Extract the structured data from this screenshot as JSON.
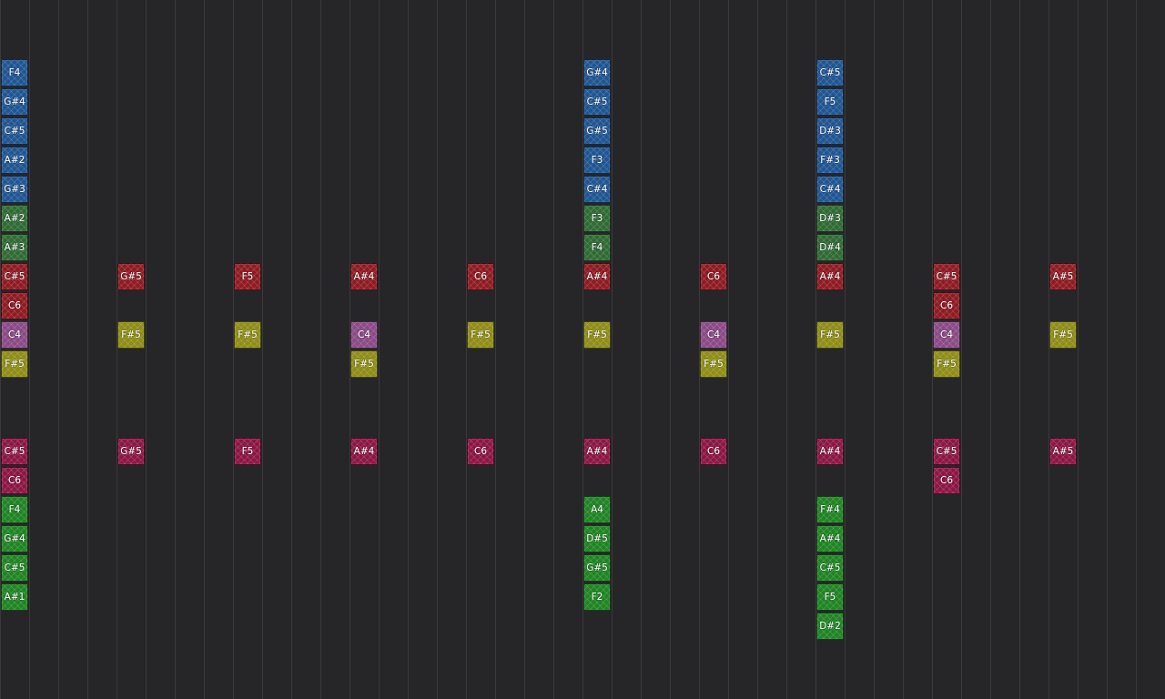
{
  "sequencer": {
    "track_colors": {
      "blue": "#1f5592",
      "dgreen": "#2f6a34",
      "red": "#8e1a22",
      "purple": "#8a4a86",
      "yellow": "#8f8d15",
      "crimson": "#8c1543",
      "green": "#1f8423"
    },
    "notes": [
      {
        "label": "F4",
        "col": 0,
        "row": 0,
        "track": "blue"
      },
      {
        "label": "G#4",
        "col": 0,
        "row": 1,
        "track": "blue"
      },
      {
        "label": "C#5",
        "col": 0,
        "row": 2,
        "track": "blue"
      },
      {
        "label": "A#2",
        "col": 0,
        "row": 3,
        "track": "blue"
      },
      {
        "label": "G#3",
        "col": 0,
        "row": 4,
        "track": "blue"
      },
      {
        "label": "A#2",
        "col": 0,
        "row": 5,
        "track": "dgreen"
      },
      {
        "label": "A#3",
        "col": 0,
        "row": 6,
        "track": "dgreen"
      },
      {
        "label": "C#5",
        "col": 0,
        "row": 7,
        "track": "red"
      },
      {
        "label": "C6",
        "col": 0,
        "row": 8,
        "track": "red"
      },
      {
        "label": "C4",
        "col": 0,
        "row": 9,
        "track": "purple"
      },
      {
        "label": "F#5",
        "col": 0,
        "row": 10,
        "track": "yellow"
      },
      {
        "label": "C#5",
        "col": 0,
        "row": 13,
        "track": "crimson"
      },
      {
        "label": "C6",
        "col": 0,
        "row": 14,
        "track": "crimson"
      },
      {
        "label": "F4",
        "col": 0,
        "row": 15,
        "track": "green"
      },
      {
        "label": "G#4",
        "col": 0,
        "row": 16,
        "track": "green"
      },
      {
        "label": "C#5",
        "col": 0,
        "row": 17,
        "track": "green"
      },
      {
        "label": "A#1",
        "col": 0,
        "row": 18,
        "track": "green"
      },
      {
        "label": "G#5",
        "col": 4,
        "row": 7,
        "track": "red"
      },
      {
        "label": "F#5",
        "col": 4,
        "row": 9,
        "track": "yellow"
      },
      {
        "label": "G#5",
        "col": 4,
        "row": 13,
        "track": "crimson"
      },
      {
        "label": "F5",
        "col": 8,
        "row": 7,
        "track": "red"
      },
      {
        "label": "F#5",
        "col": 8,
        "row": 9,
        "track": "yellow"
      },
      {
        "label": "F5",
        "col": 8,
        "row": 13,
        "track": "crimson"
      },
      {
        "label": "A#4",
        "col": 12,
        "row": 7,
        "track": "red"
      },
      {
        "label": "C4",
        "col": 12,
        "row": 9,
        "track": "purple"
      },
      {
        "label": "F#5",
        "col": 12,
        "row": 10,
        "track": "yellow"
      },
      {
        "label": "A#4",
        "col": 12,
        "row": 13,
        "track": "crimson"
      },
      {
        "label": "C6",
        "col": 16,
        "row": 7,
        "track": "red"
      },
      {
        "label": "F#5",
        "col": 16,
        "row": 9,
        "track": "yellow"
      },
      {
        "label": "C6",
        "col": 16,
        "row": 13,
        "track": "crimson"
      },
      {
        "label": "G#4",
        "col": 20,
        "row": 0,
        "track": "blue"
      },
      {
        "label": "C#5",
        "col": 20,
        "row": 1,
        "track": "blue"
      },
      {
        "label": "G#5",
        "col": 20,
        "row": 2,
        "track": "blue"
      },
      {
        "label": "F3",
        "col": 20,
        "row": 3,
        "track": "blue"
      },
      {
        "label": "C#4",
        "col": 20,
        "row": 4,
        "track": "blue"
      },
      {
        "label": "F3",
        "col": 20,
        "row": 5,
        "track": "dgreen"
      },
      {
        "label": "F4",
        "col": 20,
        "row": 6,
        "track": "dgreen"
      },
      {
        "label": "A#4",
        "col": 20,
        "row": 7,
        "track": "red"
      },
      {
        "label": "F#5",
        "col": 20,
        "row": 9,
        "track": "yellow"
      },
      {
        "label": "A#4",
        "col": 20,
        "row": 13,
        "track": "crimson"
      },
      {
        "label": "A4",
        "col": 20,
        "row": 15,
        "track": "green"
      },
      {
        "label": "D#5",
        "col": 20,
        "row": 16,
        "track": "green"
      },
      {
        "label": "G#5",
        "col": 20,
        "row": 17,
        "track": "green"
      },
      {
        "label": "F2",
        "col": 20,
        "row": 18,
        "track": "green"
      },
      {
        "label": "C6",
        "col": 24,
        "row": 7,
        "track": "red"
      },
      {
        "label": "C4",
        "col": 24,
        "row": 9,
        "track": "purple"
      },
      {
        "label": "F#5",
        "col": 24,
        "row": 10,
        "track": "yellow"
      },
      {
        "label": "C6",
        "col": 24,
        "row": 13,
        "track": "crimson"
      },
      {
        "label": "C#5",
        "col": 28,
        "row": 0,
        "track": "blue"
      },
      {
        "label": "F5",
        "col": 28,
        "row": 1,
        "track": "blue"
      },
      {
        "label": "D#3",
        "col": 28,
        "row": 2,
        "track": "blue"
      },
      {
        "label": "F#3",
        "col": 28,
        "row": 3,
        "track": "blue"
      },
      {
        "label": "C#4",
        "col": 28,
        "row": 4,
        "track": "blue"
      },
      {
        "label": "D#3",
        "col": 28,
        "row": 5,
        "track": "dgreen"
      },
      {
        "label": "D#4",
        "col": 28,
        "row": 6,
        "track": "dgreen"
      },
      {
        "label": "A#4",
        "col": 28,
        "row": 7,
        "track": "red"
      },
      {
        "label": "F#5",
        "col": 28,
        "row": 9,
        "track": "yellow"
      },
      {
        "label": "A#4",
        "col": 28,
        "row": 13,
        "track": "crimson"
      },
      {
        "label": "F#4",
        "col": 28,
        "row": 15,
        "track": "green"
      },
      {
        "label": "A#4",
        "col": 28,
        "row": 16,
        "track": "green"
      },
      {
        "label": "C#5",
        "col": 28,
        "row": 17,
        "track": "green"
      },
      {
        "label": "F5",
        "col": 28,
        "row": 18,
        "track": "green"
      },
      {
        "label": "D#2",
        "col": 28,
        "row": 19,
        "track": "green"
      },
      {
        "label": "C#5",
        "col": 32,
        "row": 7,
        "track": "red"
      },
      {
        "label": "C6",
        "col": 32,
        "row": 8,
        "track": "red"
      },
      {
        "label": "C4",
        "col": 32,
        "row": 9,
        "track": "purple"
      },
      {
        "label": "F#5",
        "col": 32,
        "row": 10,
        "track": "yellow"
      },
      {
        "label": "C#5",
        "col": 32,
        "row": 13,
        "track": "crimson"
      },
      {
        "label": "C6",
        "col": 32,
        "row": 14,
        "track": "crimson"
      },
      {
        "label": "A#5",
        "col": 36,
        "row": 7,
        "track": "red"
      },
      {
        "label": "F#5",
        "col": 36,
        "row": 9,
        "track": "yellow"
      },
      {
        "label": "A#5",
        "col": 36,
        "row": 13,
        "track": "crimson"
      }
    ]
  }
}
